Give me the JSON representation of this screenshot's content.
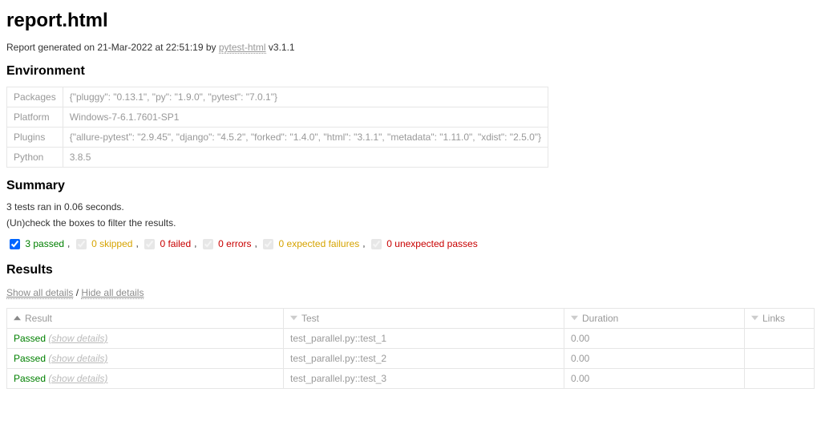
{
  "title": "report.html",
  "generated": {
    "prefix": "Report generated on ",
    "timestamp": "21-Mar-2022 at 22:51:19",
    "by": " by ",
    "plugin_name": "pytest-html",
    "version_prefix": " v",
    "version": "3.1.1"
  },
  "headings": {
    "environment": "Environment",
    "summary": "Summary",
    "results": "Results"
  },
  "environment": [
    {
      "key": "Packages",
      "value": "{\"pluggy\": \"0.13.1\", \"py\": \"1.9.0\", \"pytest\": \"7.0.1\"}"
    },
    {
      "key": "Platform",
      "value": "Windows-7-6.1.7601-SP1"
    },
    {
      "key": "Plugins",
      "value": "{\"allure-pytest\": \"2.9.45\", \"django\": \"4.5.2\", \"forked\": \"1.4.0\", \"html\": \"3.1.1\", \"metadata\": \"1.11.0\", \"xdist\": \"2.5.0\"}"
    },
    {
      "key": "Python",
      "value": "3.8.5"
    }
  ],
  "summary": {
    "ran_line": "3 tests ran in 0.06 seconds.",
    "filter_hint": "(Un)check the boxes to filter the results.",
    "filters": {
      "passed": {
        "label": "3 passed",
        "checked": true,
        "enabled": true
      },
      "skipped": {
        "label": "0 skipped",
        "checked": true,
        "enabled": false
      },
      "failed": {
        "label": "0 failed",
        "checked": true,
        "enabled": false
      },
      "errors": {
        "label": "0 errors",
        "checked": true,
        "enabled": false
      },
      "xfailed": {
        "label": "0 expected failures",
        "checked": true,
        "enabled": false
      },
      "xpassed": {
        "label": "0 unexpected passes",
        "checked": true,
        "enabled": false
      }
    }
  },
  "details": {
    "show_all": "Show all details",
    "hide_all": "Hide all details"
  },
  "columns": {
    "result": "Result",
    "test": "Test",
    "duration": "Duration",
    "links": "Links"
  },
  "rows": [
    {
      "status": "Passed",
      "details": "(show details)",
      "test": "test_parallel.py::test_1",
      "duration": "0.00",
      "links": ""
    },
    {
      "status": "Passed",
      "details": "(show details)",
      "test": "test_parallel.py::test_2",
      "duration": "0.00",
      "links": ""
    },
    {
      "status": "Passed",
      "details": "(show details)",
      "test": "test_parallel.py::test_3",
      "duration": "0.00",
      "links": ""
    }
  ]
}
